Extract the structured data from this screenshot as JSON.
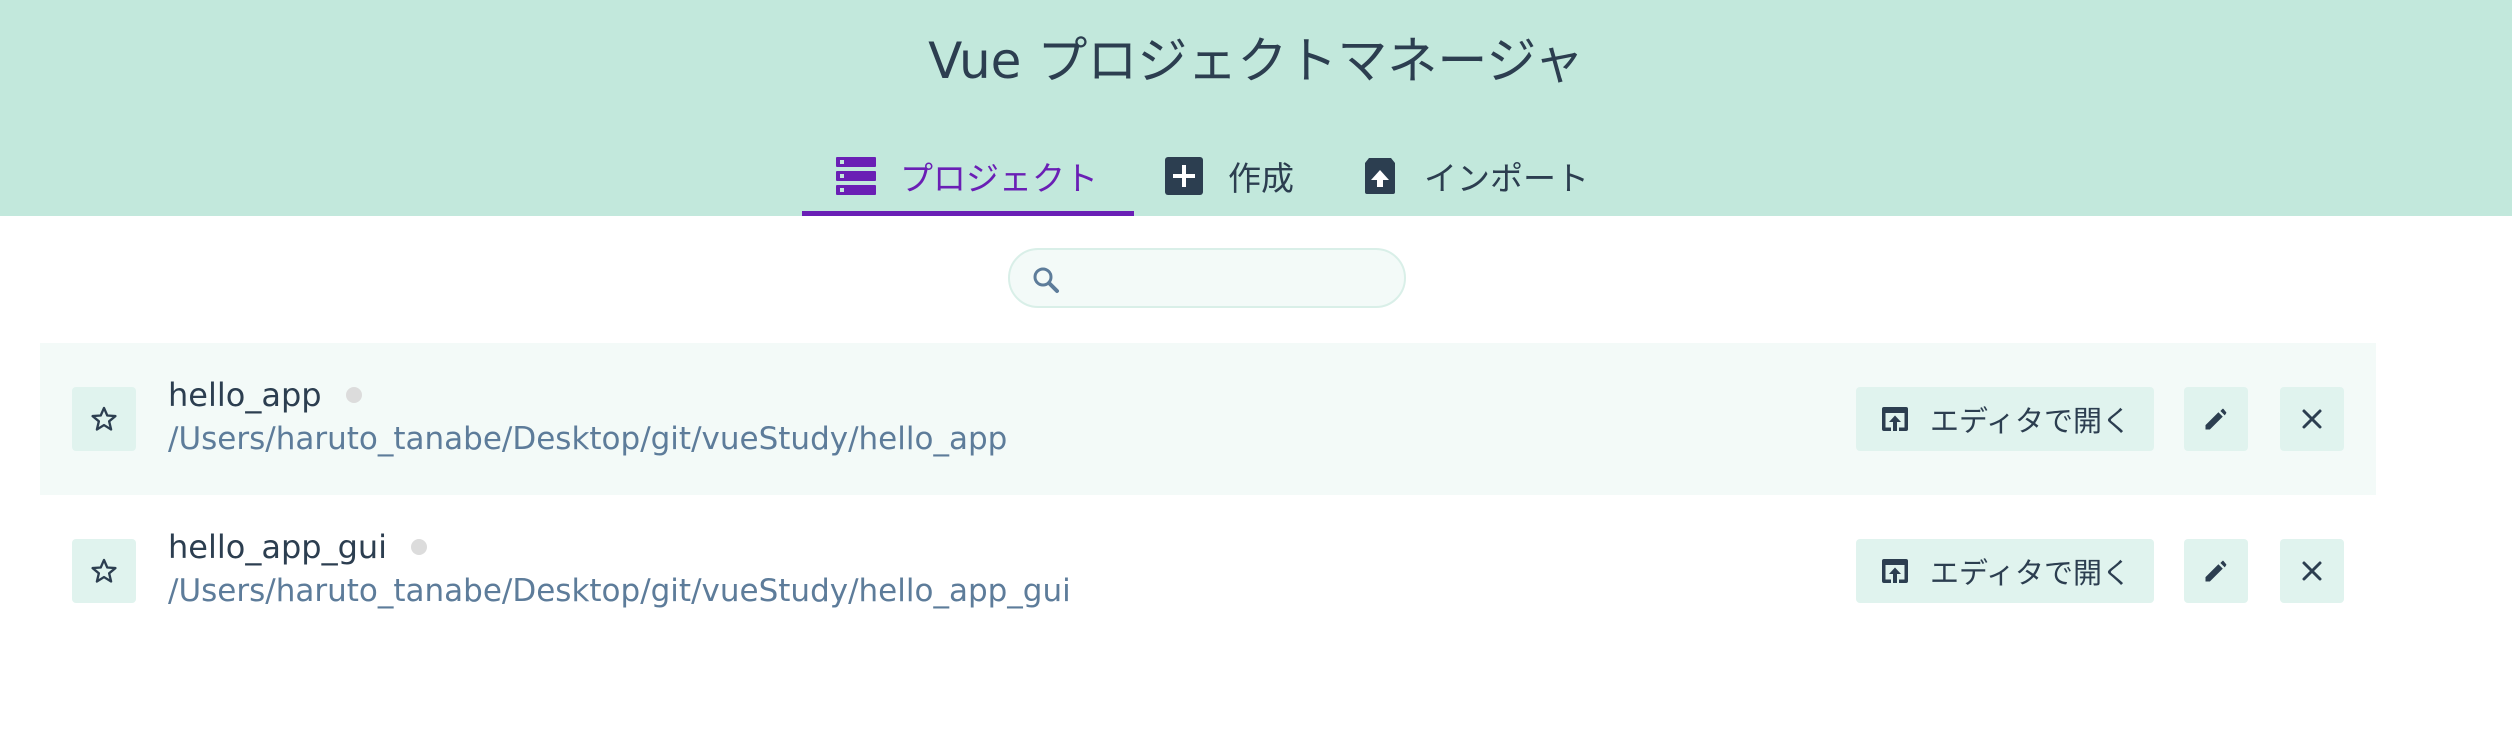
{
  "header": {
    "title": "Vue プロジェクトマネージャ",
    "tabs": [
      {
        "label": "プロジェクト",
        "icon": "list-icon",
        "active": true
      },
      {
        "label": "作成",
        "icon": "plus-box-icon",
        "active": false
      },
      {
        "label": "インポート",
        "icon": "unarchive-icon",
        "active": false
      }
    ]
  },
  "search": {
    "value": "",
    "placeholder": "",
    "icon": "search-icon"
  },
  "projects": [
    {
      "name": "hello_app",
      "path": "/Users/haruto_tanabe/Desktop/git/vueStudy/hello_app",
      "open_label": "エディタで開く"
    },
    {
      "name": "hello_app_gui",
      "path": "/Users/haruto_tanabe/Desktop/git/vueStudy/hello_app_gui",
      "open_label": "エディタで開く"
    }
  ],
  "colors": {
    "header_bg": "#c2e8dc",
    "accent": "#6a1fb5",
    "button_bg": "#e0f3ee",
    "path": "#5d7c9a"
  }
}
